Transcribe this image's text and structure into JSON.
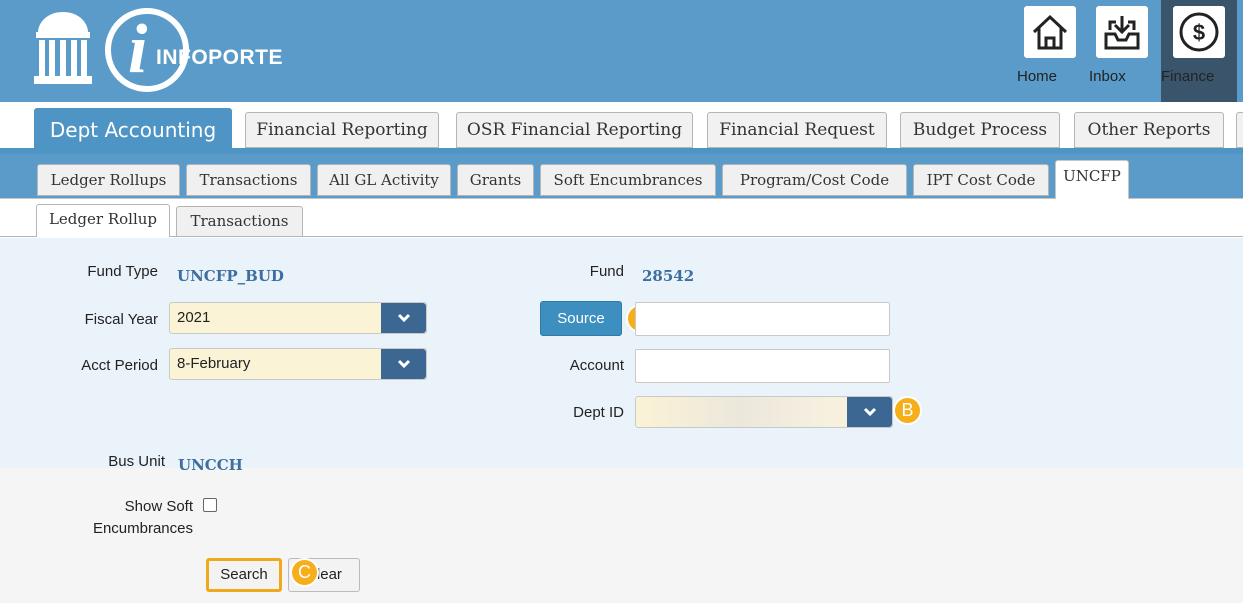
{
  "header": {
    "brand": "INFOPORTE",
    "nav": [
      {
        "label": "Home",
        "icon": "home-icon"
      },
      {
        "label": "Inbox",
        "icon": "inbox-icon"
      },
      {
        "label": "Finance",
        "icon": "dollar-icon",
        "active": true
      }
    ]
  },
  "main_tabs": [
    {
      "label": "Dept Accounting",
      "active": true
    },
    {
      "label": "Financial Reporting"
    },
    {
      "label": "OSR Financial Reporting"
    },
    {
      "label": "Financial Request"
    },
    {
      "label": "Budget Process"
    },
    {
      "label": "Other Reports"
    }
  ],
  "sub_tabs": [
    {
      "label": "Ledger Rollups"
    },
    {
      "label": "Transactions"
    },
    {
      "label": "All GL Activity"
    },
    {
      "label": "Grants"
    },
    {
      "label": "Soft Encumbrances"
    },
    {
      "label": "Program/Cost Code"
    },
    {
      "label": "IPT Cost Code"
    },
    {
      "label": "UNCFP",
      "active": true
    }
  ],
  "subsub_tabs": [
    {
      "label": "Ledger Rollup",
      "active": true
    },
    {
      "label": "Transactions"
    }
  ],
  "form": {
    "fund_type_label": "Fund Type",
    "fund_type_value": "UNCFP_BUD",
    "fund_label": "Fund",
    "fund_value": "28542",
    "fiscal_year_label": "Fiscal Year",
    "fiscal_year_value": "2021",
    "acct_period_label": "Acct Period",
    "acct_period_value": "8-February",
    "source_button": "Source",
    "source_value": "",
    "account_label": "Account",
    "account_value": "",
    "dept_id_label": "Dept ID",
    "dept_id_value": "",
    "bus_unit_label": "Bus Unit",
    "bus_unit_value": "UNCCH",
    "show_soft_label_1": "Show Soft",
    "show_soft_label_2": "Encumbrances",
    "search_button": "Search",
    "clear_button": "Clear"
  },
  "callouts": {
    "a": "A",
    "b": "B",
    "c": "C"
  },
  "colors": {
    "header_bg": "#5a9bc9",
    "active_tab": "#4e94c4",
    "finance_active": "#3a556b",
    "select_bg": "#fbf3d5",
    "select_arrow": "#3d6793",
    "callout": "#f6ae1b"
  }
}
